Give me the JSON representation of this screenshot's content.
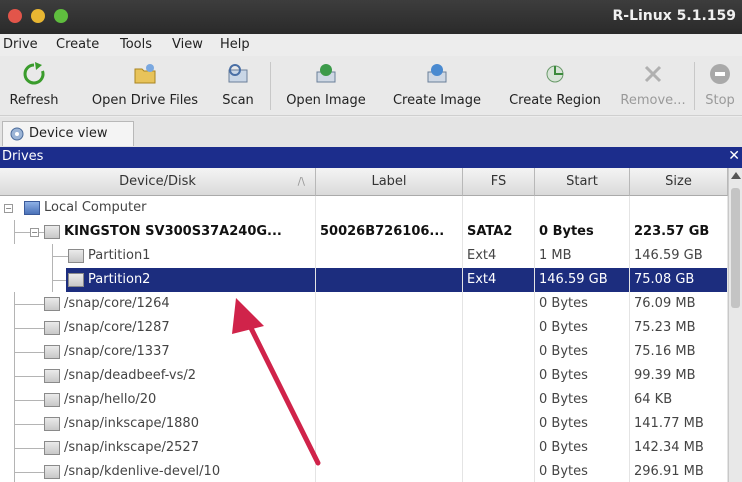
{
  "window": {
    "title": "R-Linux 5.1.159"
  },
  "menu": [
    {
      "label": "Drive"
    },
    {
      "label": "Create"
    },
    {
      "label": "Tools"
    },
    {
      "label": "View"
    },
    {
      "label": "Help"
    }
  ],
  "toolbar": {
    "refresh": "Refresh",
    "open_drive_files": "Open Drive Files",
    "scan": "Scan",
    "open_image": "Open Image",
    "create_image": "Create Image",
    "create_region": "Create Region",
    "remove": "Remove...",
    "stop": "Stop"
  },
  "tab": {
    "label": "Device view"
  },
  "panel": {
    "title": "Drives",
    "close": "✕"
  },
  "table": {
    "columns": [
      "Device/Disk",
      "Label",
      "FS",
      "Start",
      "Size"
    ],
    "sort_indicator": "/\\",
    "rows": [
      {
        "name": "Local Computer",
        "label": "",
        "fs": "",
        "start": "",
        "size": ""
      },
      {
        "name": "KINGSTON SV300S37A240G...",
        "label": "50026B726106...",
        "fs": "SATA2",
        "start": "0 Bytes",
        "size": "223.57 GB"
      },
      {
        "name": "Partition1",
        "label": "",
        "fs": "Ext4",
        "start": "1 MB",
        "size": "146.59 GB"
      },
      {
        "name": "Partition2",
        "label": "",
        "fs": "Ext4",
        "start": "146.59 GB",
        "size": "75.08 GB"
      },
      {
        "name": "/snap/core/1264",
        "label": "",
        "fs": "",
        "start": "0 Bytes",
        "size": "76.09 MB"
      },
      {
        "name": "/snap/core/1287",
        "label": "",
        "fs": "",
        "start": "0 Bytes",
        "size": "75.23 MB"
      },
      {
        "name": "/snap/core/1337",
        "label": "",
        "fs": "",
        "start": "0 Bytes",
        "size": "75.16 MB"
      },
      {
        "name": "/snap/deadbeef-vs/2",
        "label": "",
        "fs": "",
        "start": "0 Bytes",
        "size": "99.39 MB"
      },
      {
        "name": "/snap/hello/20",
        "label": "",
        "fs": "",
        "start": "0 Bytes",
        "size": "64 KB"
      },
      {
        "name": "/snap/inkscape/1880",
        "label": "",
        "fs": "",
        "start": "0 Bytes",
        "size": "141.77 MB"
      },
      {
        "name": "/snap/inkscape/2527",
        "label": "",
        "fs": "",
        "start": "0 Bytes",
        "size": "142.34 MB"
      },
      {
        "name": "/snap/kdenlive-devel/10",
        "label": "",
        "fs": "",
        "start": "0 Bytes",
        "size": "296.91 MB"
      }
    ]
  },
  "colors": {
    "selection": "#1c2d7e",
    "panel_header": "#1c2d8c",
    "annotation_arrow": "#d0234a"
  },
  "icons": {
    "refresh": "refresh-icon",
    "open_drive_files": "folder-open-icon",
    "scan": "scan-icon",
    "open_image": "open-image-icon",
    "create_image": "create-image-icon",
    "create_region": "create-region-icon",
    "remove": "remove-icon",
    "stop": "stop-icon"
  }
}
